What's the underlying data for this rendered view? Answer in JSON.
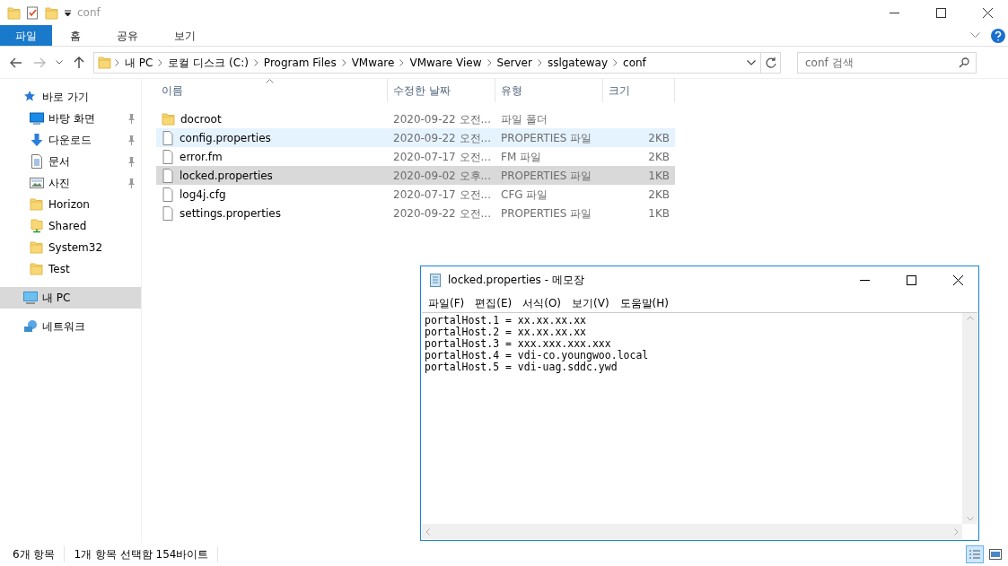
{
  "window": {
    "title": "conf"
  },
  "ribbon_tabs": [
    {
      "label": "파일",
      "selected": true
    },
    {
      "label": "홈",
      "selected": false
    },
    {
      "label": "공유",
      "selected": false
    },
    {
      "label": "보기",
      "selected": false
    }
  ],
  "address_bar": {
    "path": [
      {
        "label": "내 PC"
      },
      {
        "label": "로컬 디스크 (C:)"
      },
      {
        "label": "Program Files"
      },
      {
        "label": "VMware"
      },
      {
        "label": "VMware View"
      },
      {
        "label": "Server"
      },
      {
        "label": "sslgateway"
      },
      {
        "label": "conf"
      }
    ]
  },
  "search": {
    "placeholder": "conf 검색"
  },
  "sidebar": {
    "items": [
      {
        "label": "바로 가기",
        "kind": "star",
        "pinned": false,
        "selected": false,
        "children": [
          {
            "label": "바탕 화면",
            "kind": "desktop",
            "pinned": true,
            "selected": false
          },
          {
            "label": "다운로드",
            "kind": "download",
            "pinned": true,
            "selected": false
          },
          {
            "label": "문서",
            "kind": "document",
            "pinned": true,
            "selected": false
          },
          {
            "label": "사진",
            "kind": "picture",
            "pinned": true,
            "selected": false
          },
          {
            "label": "Horizon",
            "kind": "folder",
            "pinned": false,
            "selected": false
          },
          {
            "label": "Shared",
            "kind": "shared",
            "pinned": false,
            "selected": false
          },
          {
            "label": "System32",
            "kind": "folder",
            "pinned": false,
            "selected": false
          },
          {
            "label": "Test",
            "kind": "folder",
            "pinned": false,
            "selected": false
          }
        ]
      },
      {
        "label": "내 PC",
        "kind": "pc",
        "pinned": false,
        "selected": true
      },
      {
        "label": "네트워크",
        "kind": "network",
        "pinned": false,
        "selected": false
      }
    ]
  },
  "table": {
    "columns": [
      "이름",
      "수정한 날짜",
      "유형",
      "크기"
    ],
    "rows": [
      {
        "kind": "folder",
        "name": "docroot",
        "date": "2020-09-22 오전...",
        "type": "파일 폴더",
        "size": "",
        "selected": false,
        "hovered": false
      },
      {
        "kind": "file",
        "name": "config.properties",
        "date": "2020-09-22 오전...",
        "type": "PROPERTIES 파일",
        "size": "2KB",
        "selected": false,
        "hovered": true
      },
      {
        "kind": "file",
        "name": "error.fm",
        "date": "2020-07-17 오전...",
        "type": "FM 파일",
        "size": "2KB",
        "selected": false,
        "hovered": false
      },
      {
        "kind": "file",
        "name": "locked.properties",
        "date": "2020-09-02 오후...",
        "type": "PROPERTIES 파일",
        "size": "1KB",
        "selected": true,
        "hovered": false
      },
      {
        "kind": "file",
        "name": "log4j.cfg",
        "date": "2020-07-17 오전...",
        "type": "CFG 파일",
        "size": "2KB",
        "selected": false,
        "hovered": false
      },
      {
        "kind": "file",
        "name": "settings.properties",
        "date": "2020-09-22 오전...",
        "type": "PROPERTIES 파일",
        "size": "1KB",
        "selected": false,
        "hovered": false
      }
    ]
  },
  "status_bar": {
    "item_count": "6개 항목",
    "selection": "1개 항목 선택함 154바이트"
  },
  "notepad": {
    "title": "locked.properties - 메모장",
    "menu": [
      "파일(F)",
      "편집(E)",
      "서식(O)",
      "보기(V)",
      "도움말(H)"
    ],
    "lines": [
      "portalHost.1 = xx.xx.xx.xx",
      "portalHost.2 = xx.xx.xx.xx",
      "portalHost.3 = xxx.xxx.xxx.xxx",
      "portalHost.4 = vdi-co.youngwoo.local",
      "portalHost.5 = vdi-uag.sddc.ywd"
    ]
  }
}
